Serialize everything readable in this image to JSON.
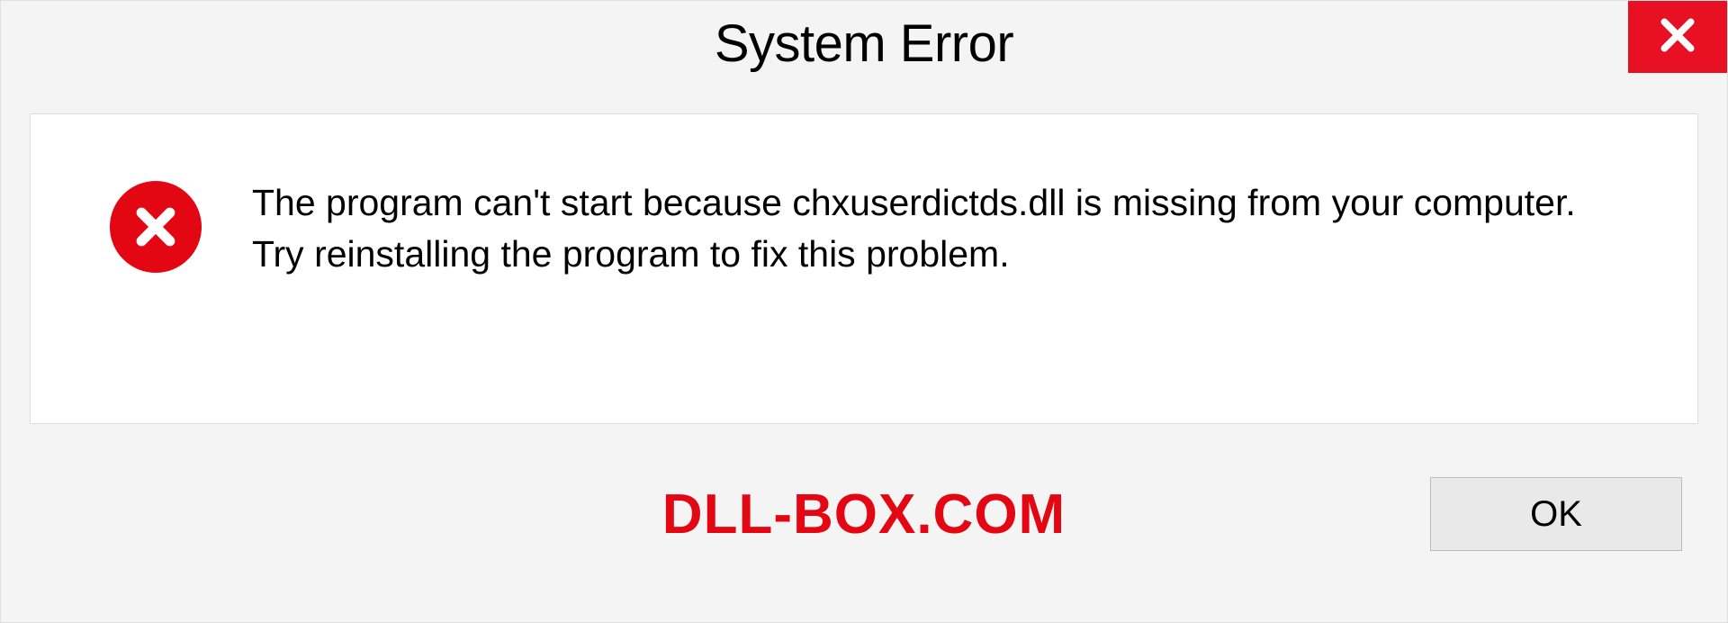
{
  "dialog": {
    "title": "System Error",
    "message": "The program can't start because chxuserdictds.dll is missing from your computer. Try reinstalling the program to fix this problem.",
    "ok_label": "OK"
  },
  "watermark": "DLL-BOX.COM",
  "colors": {
    "close_bg": "#e81123",
    "error_bg": "#e30613",
    "accent": "#e30613"
  }
}
